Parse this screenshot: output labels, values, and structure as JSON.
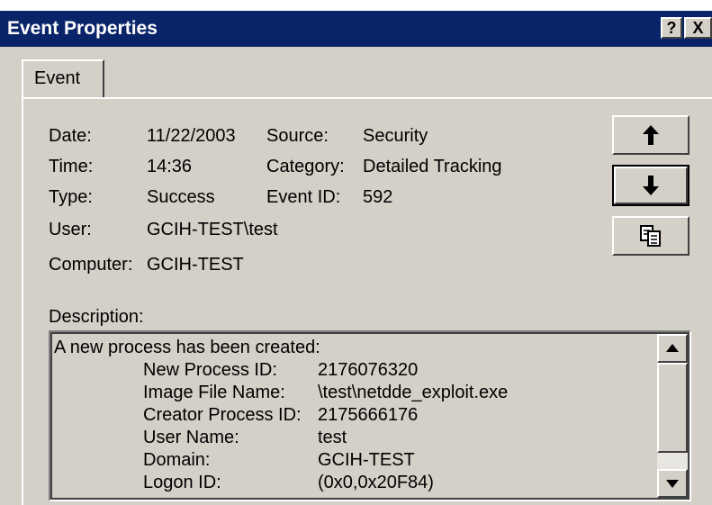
{
  "window": {
    "title": "Event Properties",
    "help_label": "?",
    "close_label": "X"
  },
  "tabs": [
    {
      "label": "Event"
    }
  ],
  "fields": {
    "date_label": "Date:",
    "date_value": "11/22/2003",
    "time_label": "Time:",
    "time_value": "14:36",
    "type_label": "Type:",
    "type_value": "Success",
    "user_label": "User:",
    "user_value": "GCIH-TEST\\test",
    "computer_label": "Computer:",
    "computer_value": "GCIH-TEST",
    "source_label": "Source:",
    "source_value": "Security",
    "category_label": "Category:",
    "category_value": "Detailed Tracking",
    "eventid_label": "Event ID:",
    "eventid_value": "592"
  },
  "buttons": {
    "prev_icon": "up-arrow-icon",
    "next_icon": "down-arrow-icon",
    "copy_icon": "copy-icon"
  },
  "description": {
    "label": "Description:",
    "intro": "A new process has been created:",
    "rows": [
      {
        "key": "New Process ID:",
        "value": "2176076320"
      },
      {
        "key": "Image File Name:",
        "value": "\\test\\netdde_exploit.exe"
      },
      {
        "key": "Creator Process ID:",
        "value": "2175666176"
      },
      {
        "key": "User Name:",
        "value": "test"
      },
      {
        "key": "Domain:",
        "value": "GCIH-TEST"
      },
      {
        "key": "Logon ID:",
        "value": "(0x0,0x20F84)"
      }
    ]
  },
  "colors": {
    "titlebar": "#0a246a",
    "face": "#d4d0c8"
  }
}
